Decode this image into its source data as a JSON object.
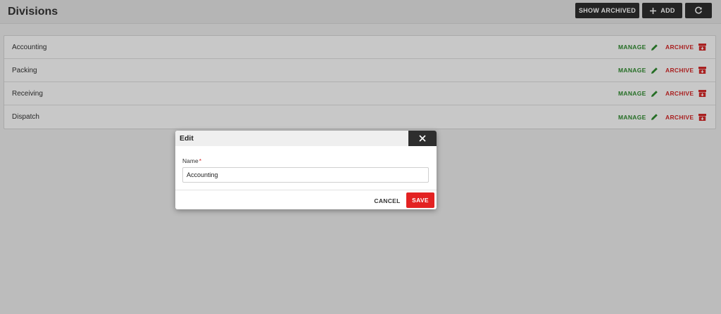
{
  "header": {
    "title": "Divisions",
    "show_archived_label": "SHOW ARCHIVED",
    "add_label": "ADD"
  },
  "divisions": [
    {
      "name": "Accounting",
      "manage_label": "MANAGE",
      "archive_label": "ARCHIVE"
    },
    {
      "name": "Packing",
      "manage_label": "MANAGE",
      "archive_label": "ARCHIVE"
    },
    {
      "name": "Receiving",
      "manage_label": "MANAGE",
      "archive_label": "ARCHIVE"
    },
    {
      "name": "Dispatch",
      "manage_label": "MANAGE",
      "archive_label": "ARCHIVE"
    }
  ],
  "dialog": {
    "title": "Edit",
    "name_label": "Name",
    "required_marker": "*",
    "name_value": "Accounting",
    "cancel_label": "CANCEL",
    "save_label": "SAVE"
  },
  "icons": {
    "add": "plus-icon",
    "refresh": "refresh-icon",
    "manage": "pencil-icon",
    "archive": "archive-box-icon",
    "close": "close-icon"
  },
  "colors": {
    "manage": "#2f8a2f",
    "archive": "#d42828",
    "save": "#e32222",
    "dark_button": "#2e2e2e"
  }
}
